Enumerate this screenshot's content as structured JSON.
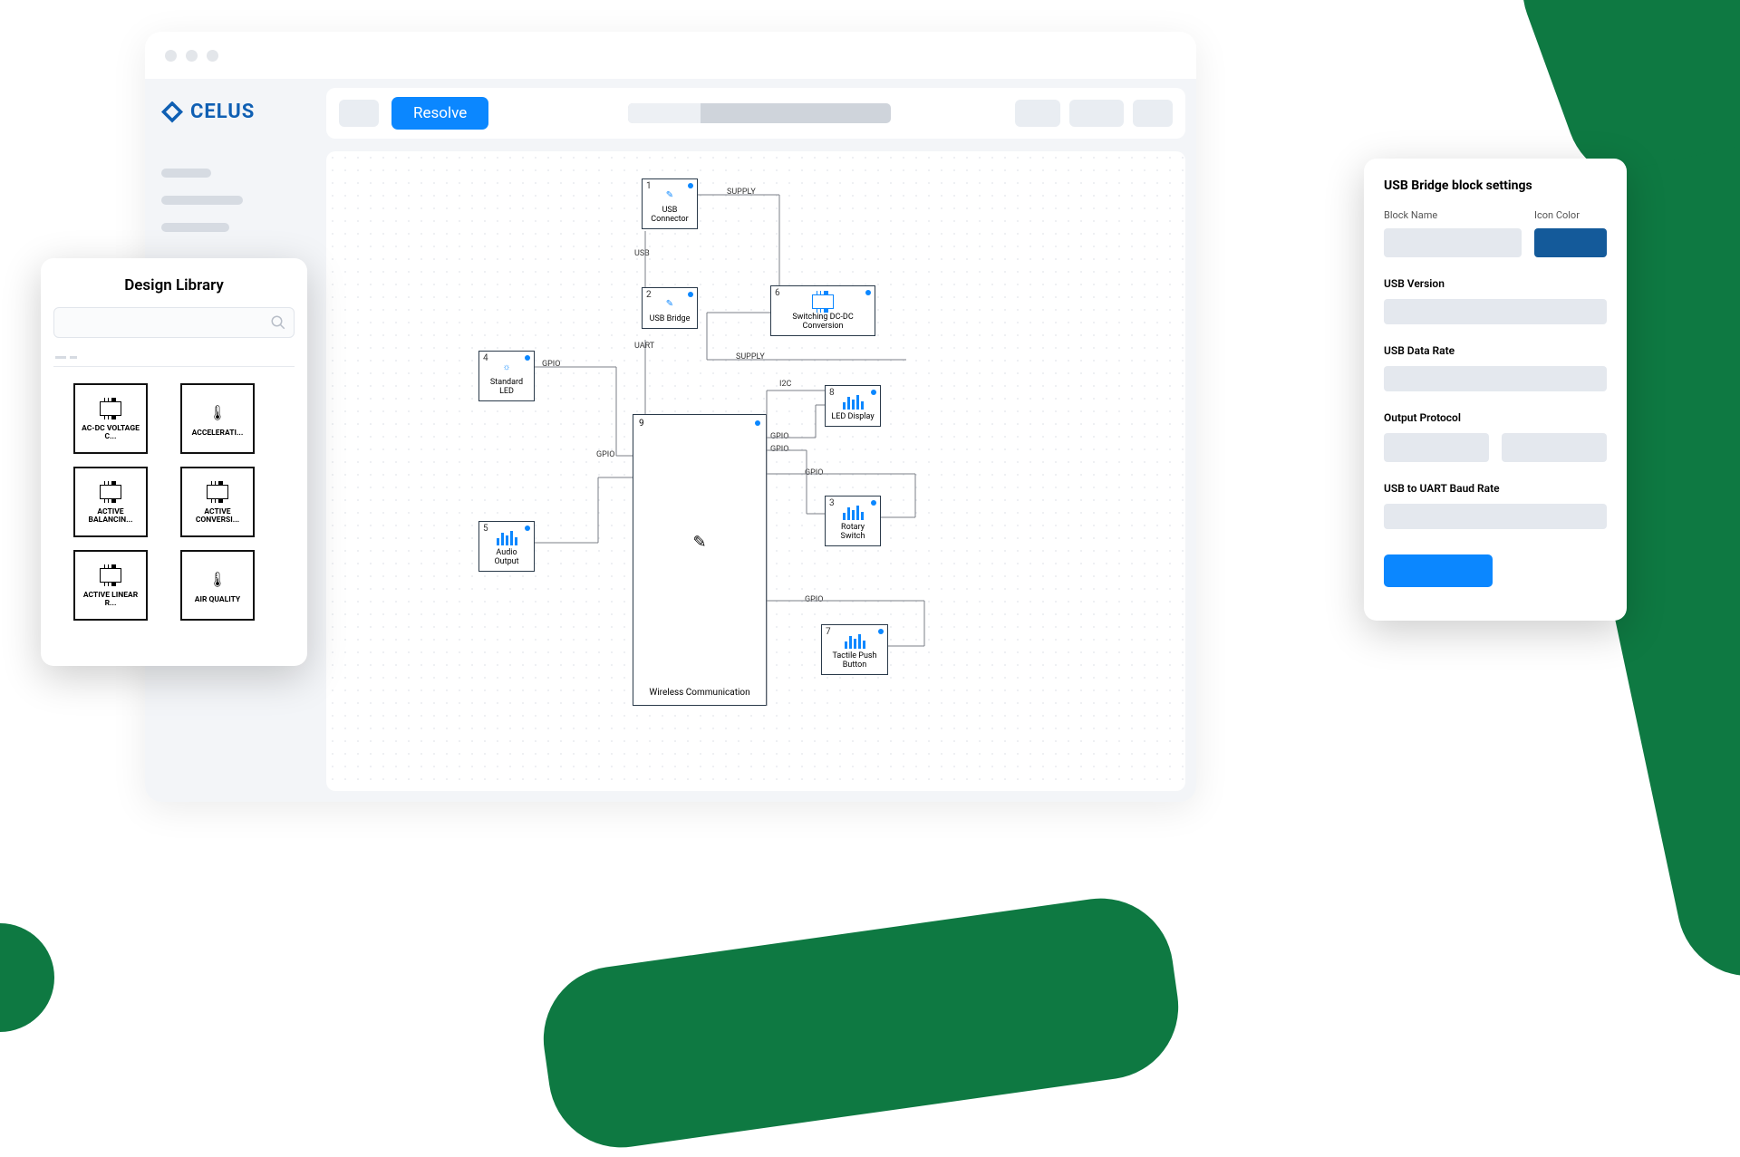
{
  "brand": "CELUS",
  "toolbar": {
    "resolve": "Resolve"
  },
  "library": {
    "title": "Design Library",
    "items": [
      {
        "label": "AC-DC VOLTAGE C..."
      },
      {
        "label": "ACCELERATI..."
      },
      {
        "label": "ACTIVE BALANCIN..."
      },
      {
        "label": "ACTIVE CONVERSI..."
      },
      {
        "label": "ACTIVE LINEAR R..."
      },
      {
        "label": "AIR QUALITY"
      }
    ]
  },
  "canvas": {
    "blocks": {
      "b1": {
        "num": "1",
        "label": "USB Connector"
      },
      "b2": {
        "num": "2",
        "label": "USB Bridge"
      },
      "b3": {
        "num": "3",
        "label": "Rotary Switch"
      },
      "b4": {
        "num": "4",
        "label": "Standard LED"
      },
      "b5": {
        "num": "5",
        "label": "Audio Output"
      },
      "b6": {
        "num": "6",
        "label": "Switching DC-DC Conversion"
      },
      "b7": {
        "num": "7",
        "label": "Tactile Push Button"
      },
      "b8": {
        "num": "8",
        "label": "LED Display"
      },
      "b9": {
        "num": "9",
        "label": "Wireless Communication"
      }
    },
    "ports": {
      "supply1": "SUPPLY",
      "usb": "USB",
      "uart": "UART",
      "supply2": "SUPPLY",
      "gpio1": "GPIO",
      "gpio2": "GPIO",
      "i2c": "I2C",
      "gpio3": "GPIO",
      "gpio4": "GPIO",
      "gpio5": "GPIO",
      "gpio6": "GPIO"
    }
  },
  "settings": {
    "title": "USB Bridge block settings",
    "block_name_label": "Block Name",
    "icon_color_label": "Icon Color",
    "usb_version_label": "USB Version",
    "usb_data_rate_label": "USB Data Rate",
    "output_protocol_label": "Output Protocol",
    "uart_baud_label": "USB to UART Baud Rate"
  }
}
